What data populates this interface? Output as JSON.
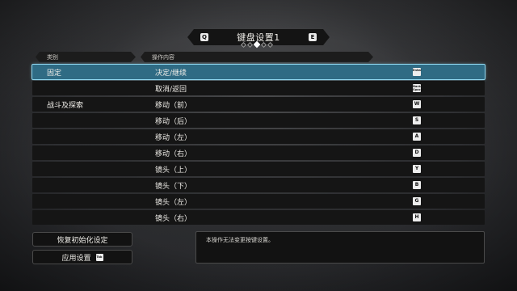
{
  "header": {
    "title": "键盘设置1",
    "prev_key": "Q",
    "next_key": "E",
    "page_dots": 5,
    "active_dot": 3
  },
  "columns": {
    "category": "类别",
    "operation": "操作内容"
  },
  "rows": [
    {
      "category": "固定",
      "operation": "决定/继续",
      "key": "Enter",
      "selected": true
    },
    {
      "category": "",
      "operation": "取消/返回",
      "key": "Back Space",
      "selected": false
    },
    {
      "category": "战斗及探索",
      "operation": "移动（前）",
      "key": "W",
      "selected": false
    },
    {
      "category": "",
      "operation": "移动（后）",
      "key": "S",
      "selected": false
    },
    {
      "category": "",
      "operation": "移动（左）",
      "key": "A",
      "selected": false
    },
    {
      "category": "",
      "operation": "移动（右）",
      "key": "D",
      "selected": false
    },
    {
      "category": "",
      "operation": "镜头（上）",
      "key": "Y",
      "selected": false
    },
    {
      "category": "",
      "operation": "镜头（下）",
      "key": "B",
      "selected": false
    },
    {
      "category": "",
      "operation": "镜头（左）",
      "key": "G",
      "selected": false
    },
    {
      "category": "",
      "operation": "镜头（右）",
      "key": "H",
      "selected": false
    }
  ],
  "buttons": {
    "reset_label": "恢复初始化设定",
    "apply_label": "应用设置",
    "apply_key": "Tab"
  },
  "info_text": "本操作无法变更按键设置。",
  "colors": {
    "selected_row": "#2f6b84",
    "selected_outline": "#8fd6ee",
    "row_bg": "#151515"
  }
}
